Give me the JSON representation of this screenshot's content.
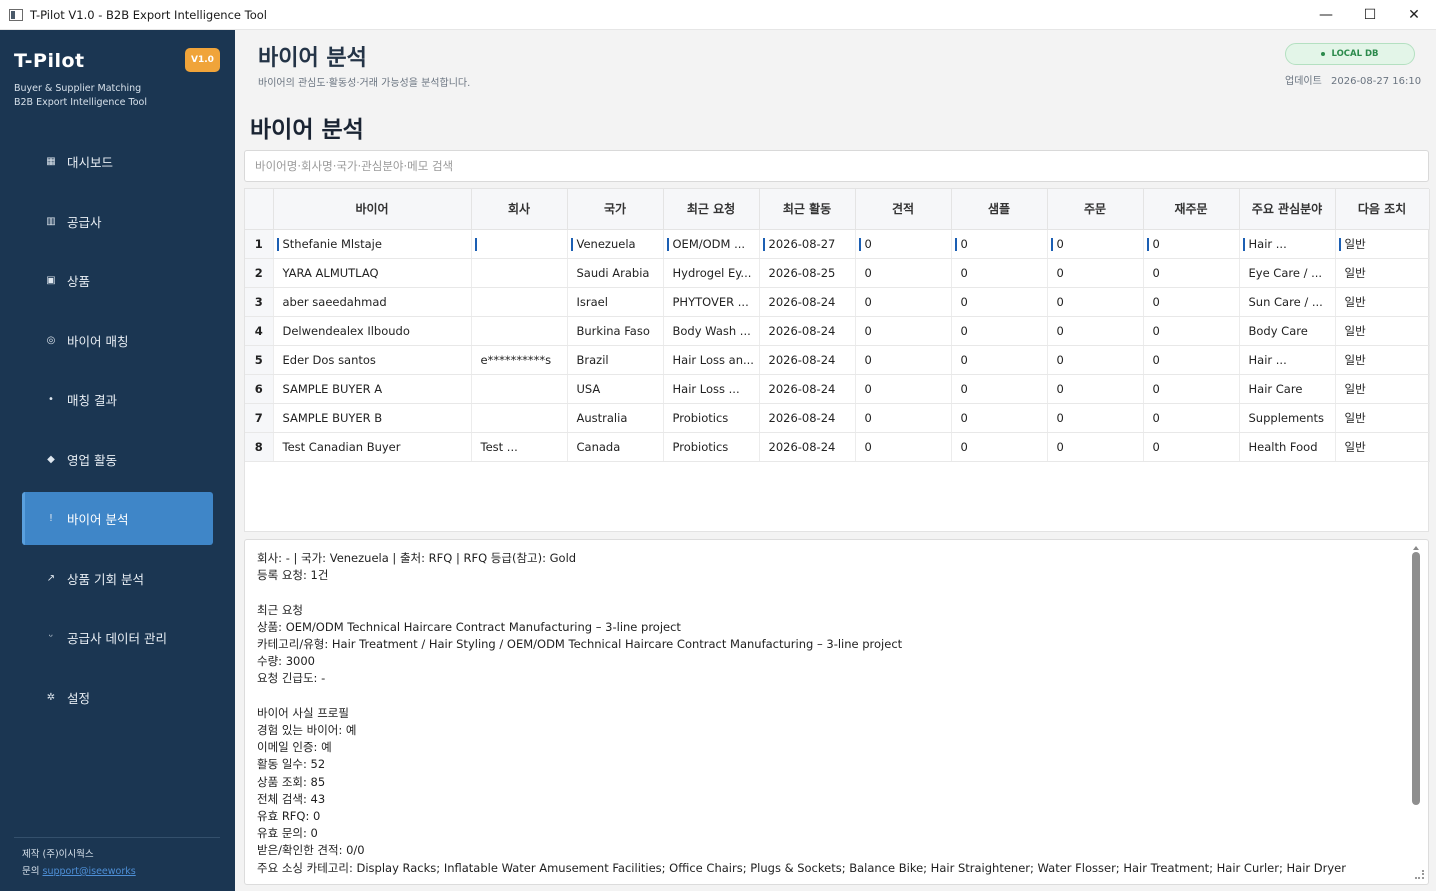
{
  "window": {
    "title": "T-Pilot V1.0 - B2B Export Intelligence Tool",
    "minimize": "—",
    "maximize": "☐",
    "close": "✕"
  },
  "sidebar": {
    "brand": "T-Pilot",
    "version": "V1.0",
    "subtitle_1": "Buyer & Supplier Matching",
    "subtitle_2": "B2B Export Intelligence Tool",
    "items": [
      {
        "label": "대시보드",
        "icon": "dashboard-icon",
        "glyph": "▦"
      },
      {
        "label": "공급사",
        "icon": "supplier-icon",
        "glyph": "▥"
      },
      {
        "label": "상품",
        "icon": "product-icon",
        "glyph": "▣"
      },
      {
        "label": "바이어 매칭",
        "icon": "matching-icon",
        "glyph": "◎"
      },
      {
        "label": "매칭 결과",
        "icon": "result-icon",
        "glyph": "•"
      },
      {
        "label": "영업 활동",
        "icon": "diamond-icon",
        "glyph": "◆"
      },
      {
        "label": "바이어 분석",
        "icon": "analysis-icon",
        "glyph": "ǃ"
      },
      {
        "label": "상품 기회 분석",
        "icon": "trend-icon",
        "glyph": "↗"
      },
      {
        "label": "공급사 데이터 관리",
        "icon": "data-icon",
        "glyph": "ᵕ"
      },
      {
        "label": "설정",
        "icon": "gear-icon",
        "glyph": "✲"
      }
    ],
    "active_index": 6,
    "footer_maker": "제작 (주)이시웍스",
    "footer_contact_label": "문의",
    "footer_contact_value": "support@iseeworks"
  },
  "header": {
    "title": "바이어 분석",
    "subtitle": "바이어의 관심도·활동성·거래 가능성을 분석합니다.",
    "db_badge": "LOCAL DB",
    "updated_label": "업데이트",
    "updated_value": "2026-08-27 16:10"
  },
  "section": {
    "title": "바이어 분석",
    "search_placeholder": "바이어명·회사명·국가·관심분야·메모 검색"
  },
  "table": {
    "columns": [
      "바이어",
      "회사",
      "국가",
      "최근 요청",
      "최근 활동",
      "견적",
      "샘플",
      "주문",
      "재주문",
      "주요 관심분야",
      "다음 조치"
    ],
    "rows": [
      [
        "Sthefanie Mlstaje",
        "",
        "Venezuela",
        "OEM/ODM ...",
        "2026-08-27",
        "0",
        "0",
        "0",
        "0",
        "Hair ...",
        "일반"
      ],
      [
        "YARA ALMUTLAQ",
        "",
        "Saudi Arabia",
        "Hydrogel Ey...",
        "2026-08-25",
        "0",
        "0",
        "0",
        "0",
        "Eye Care / ...",
        "일반"
      ],
      [
        "aber saeedahmad",
        "",
        "Israel",
        "PHYTOVER ...",
        "2026-08-24",
        "0",
        "0",
        "0",
        "0",
        "Sun Care / ...",
        "일반"
      ],
      [
        "Delwendealex Ilboudo",
        "",
        "Burkina Faso",
        "Body Wash ...",
        "2026-08-24",
        "0",
        "0",
        "0",
        "0",
        "Body Care",
        "일반"
      ],
      [
        "Eder Dos santos",
        "e**********s",
        "Brazil",
        "Hair Loss an...",
        "2026-08-24",
        "0",
        "0",
        "0",
        "0",
        "Hair ...",
        "일반"
      ],
      [
        "SAMPLE BUYER A",
        "",
        "USA",
        "Hair Loss ...",
        "2026-08-24",
        "0",
        "0",
        "0",
        "0",
        "Hair Care",
        "일반"
      ],
      [
        "SAMPLE BUYER B",
        "",
        "Australia",
        "Probiotics",
        "2026-08-24",
        "0",
        "0",
        "0",
        "0",
        "Supplements",
        "일반"
      ],
      [
        "Test Canadian Buyer",
        "Test ...",
        "Canada",
        "Probiotics",
        "2026-08-24",
        "0",
        "0",
        "0",
        "0",
        "Health Food",
        "일반"
      ]
    ]
  },
  "detail": {
    "lines": [
      "회사: - | 국가: Venezuela | 출처: RFQ | RFQ 등급(참고): Gold",
      "등록 요청: 1건",
      "",
      "최근 요청",
      "상품: OEM/ODM Technical Haircare Contract Manufacturing – 3-line project",
      "카테고리/유형: Hair Treatment / Hair Styling / OEM/ODM Technical Haircare Contract Manufacturing – 3-line project",
      "수량: 3000",
      "요청 긴급도: -",
      "",
      "바이어 사실 프로필",
      "경험 있는 바이어: 예",
      "이메일 인증: 예",
      "활동 일수: 52",
      "상품 조회: 85",
      "전체 검색: 43",
      "유효 RFQ: 0",
      "유효 문의: 0",
      "받은/확인한 견적: 0/0",
      "주요 소싱 카테고리: Display Racks; Inflatable Water Amusement Facilities; Office Chairs; Plugs & Sockets; Balance Bike; Hair Straightener; Water Flosser; Hair Treatment; Hair Curler; Hair Dryer"
    ]
  }
}
